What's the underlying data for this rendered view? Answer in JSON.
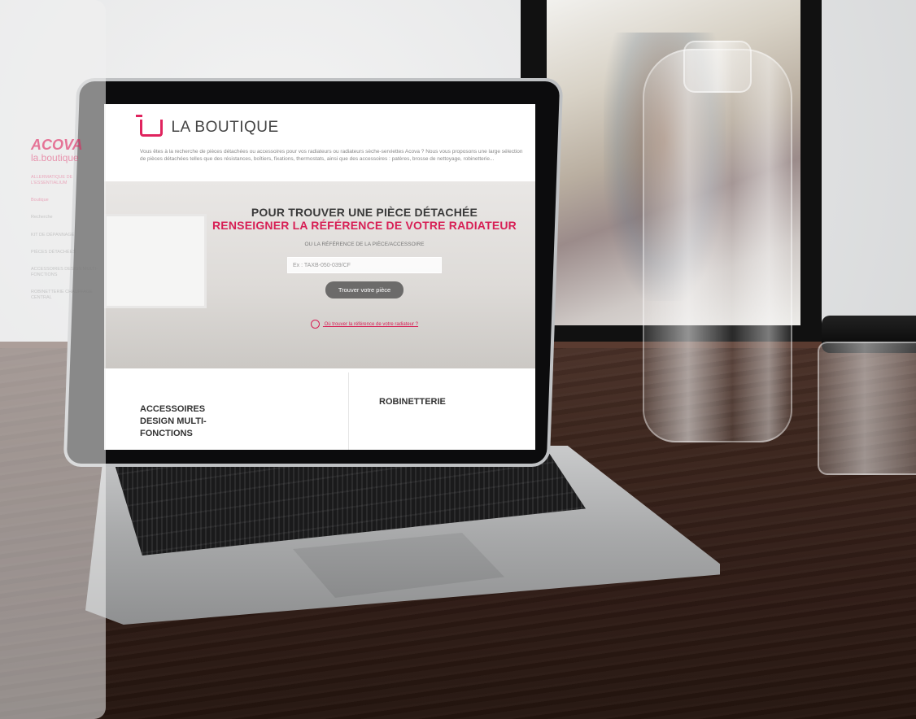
{
  "site": {
    "section_title": "LA BOUTIQUE",
    "intro_line1": "Vous êtes à la recherche de pièces détachées ou accessoires pour vos radiateurs ou radiateurs sèche-serviettes Acova ? Nous vous proposons une large sélection",
    "intro_line2": "de pièces détachées telles que des résistances, boîtiers, fixations, thermostats, ainsi que des accessoires : patères, brosse de nettoyage, robinetterie...",
    "hero": {
      "line1": "POUR TROUVER UNE PIÈCE DÉTACHÉE",
      "line2": "RENSEIGNER LA RÉFÉRENCE DE VOTRE RADIATEUR",
      "subline": "OU LA RÉFÉRENCE DE LA PIÈCE/ACCESSOIRE",
      "search_placeholder": "Ex : TAXB-050-039/CF",
      "button_label": "Trouver votre pièce",
      "help_link": "Où trouver la référence de votre radiateur ?"
    },
    "categories": {
      "left": "ACCESSOIRES DESIGN MULTI-FONCTIONS",
      "right": "ROBINETTERIE"
    }
  },
  "sidebar": {
    "brand": "ACOVA",
    "logo_text": "la.boutique",
    "items": [
      "ALLERMATIQUE DE L'ESSENTIALIUM",
      "Boutique",
      "Recherche",
      "KIT DE DÉPANNAGE",
      "PIÈCES DÉTACHÉES",
      "ACCESSOIRES DESIGN MULTI-FONCTIONS",
      "ROBINETTERIE CHAUFFAGE CENTRAL"
    ]
  },
  "colors": {
    "brand": "#e0245e",
    "button": "#6c6b6a"
  }
}
